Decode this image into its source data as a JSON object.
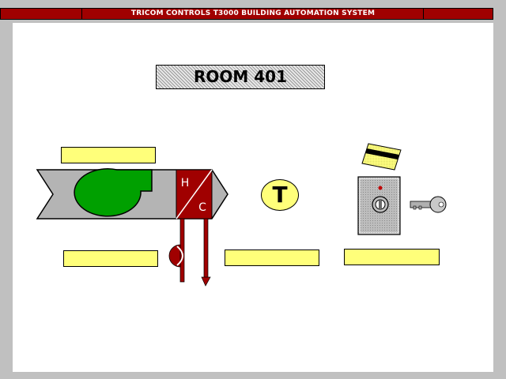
{
  "window": {
    "title": "TRICOM CONTROLS T3000 BUILDING AUTOMATION SYSTEM"
  },
  "room": {
    "title": "ROOM 401"
  },
  "air_handler": {
    "heat_label": "H",
    "cool_label": "C"
  },
  "thermostat": {
    "label": "T"
  },
  "fields": {
    "fan_status": "",
    "damper_status": "",
    "temperature": "",
    "keycard": ""
  },
  "colors": {
    "titlebar": "#a00000",
    "duct": "#b4b4b4",
    "fan": "#00a000",
    "coil": "#a00000",
    "field": "#ffff7a"
  }
}
